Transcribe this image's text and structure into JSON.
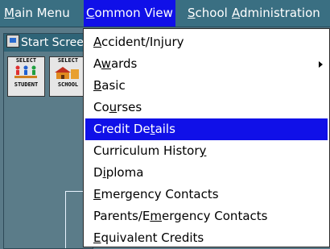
{
  "menubar": {
    "items": [
      {
        "pre": "",
        "acc": "M",
        "post": "ain Menu"
      },
      {
        "pre": "",
        "acc": "C",
        "post": "ommon View"
      },
      {
        "pre": "",
        "acc": "S",
        "post": "chool"
      },
      {
        "pre": "",
        "acc": "A",
        "post": "dministration"
      }
    ],
    "active_index": 1
  },
  "window": {
    "title": "Start Screen",
    "buttons": [
      {
        "line1": "SELECT",
        "line2": "STUDENT"
      },
      {
        "line1": "SELECT",
        "line2": "SCHOOL"
      }
    ]
  },
  "dropdown": {
    "items": [
      {
        "pre": "",
        "acc": "A",
        "post": "ccident/Injury"
      },
      {
        "pre": "A",
        "acc": "w",
        "post": "ards",
        "submenu": true
      },
      {
        "pre": "",
        "acc": "B",
        "post": "asic"
      },
      {
        "pre": "Co",
        "acc": "u",
        "post": "rses"
      },
      {
        "pre": "Credit De",
        "acc": "t",
        "post": "ails",
        "selected": true
      },
      {
        "pre": "Curriculum Histor",
        "acc": "y",
        "post": ""
      },
      {
        "pre": "D",
        "acc": "i",
        "post": "ploma"
      },
      {
        "pre": "",
        "acc": "E",
        "post": "mergency Contacts"
      },
      {
        "pre": "Parents/E",
        "acc": "m",
        "post": "ergency Contacts"
      },
      {
        "pre": "",
        "acc": "E",
        "post": "quivalent Credits"
      }
    ]
  },
  "colors": {
    "menubar_bg": "#3a6f82",
    "highlight": "#1010e8",
    "desktop": "#5a7a88"
  }
}
